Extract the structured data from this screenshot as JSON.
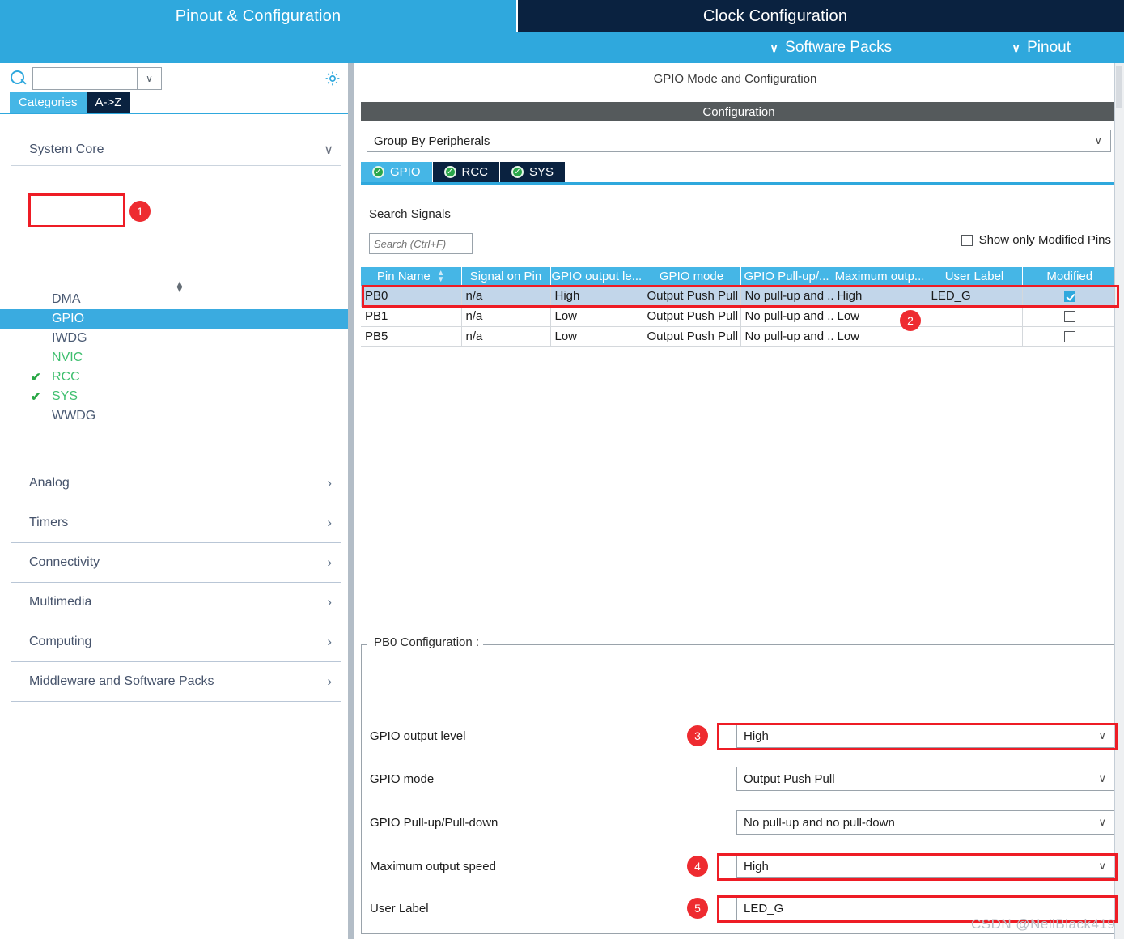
{
  "main_tabs": [
    {
      "label": "Pinout & Configuration",
      "active": true
    },
    {
      "label": "Clock Configuration",
      "active": false
    }
  ],
  "second_bar": {
    "software_packs": "Software Packs",
    "pinout": "Pinout",
    "chevron": "∨"
  },
  "left_panel": {
    "search": {
      "value": "",
      "placeholder": ""
    },
    "gear_icon": "gear-icon",
    "tabs": [
      {
        "label": "Categories",
        "active": true
      },
      {
        "label": "A->Z",
        "active": false
      }
    ],
    "section": {
      "label": "System Core",
      "arrow": "∨"
    },
    "tree_items": [
      {
        "label": "DMA",
        "check": false,
        "green": false,
        "selected": false
      },
      {
        "label": "GPIO",
        "check": false,
        "green": false,
        "selected": true
      },
      {
        "label": "IWDG",
        "check": false,
        "green": false,
        "selected": false
      },
      {
        "label": "NVIC",
        "check": false,
        "green": true,
        "selected": false
      },
      {
        "label": "RCC",
        "check": true,
        "green": true,
        "selected": false
      },
      {
        "label": "SYS",
        "check": true,
        "green": true,
        "selected": false
      },
      {
        "label": "WWDG",
        "check": false,
        "green": false,
        "selected": false
      }
    ],
    "categories": [
      {
        "label": "Analog",
        "arrow": "›"
      },
      {
        "label": "Timers",
        "arrow": "›"
      },
      {
        "label": "Connectivity",
        "arrow": "›"
      },
      {
        "label": "Multimedia",
        "arrow": "›"
      },
      {
        "label": "Computing",
        "arrow": "›"
      },
      {
        "label": "Middleware and Software Packs",
        "arrow": "›"
      }
    ]
  },
  "right_panel": {
    "mode_title": "GPIO Mode and Configuration",
    "configuration_title": "Configuration",
    "group_by": {
      "value": "Group By Peripherals",
      "chevron": "∨"
    },
    "peripheral_tabs": [
      {
        "label": "GPIO",
        "active": true,
        "status": "ok"
      },
      {
        "label": "RCC",
        "active": false,
        "status": "ok"
      },
      {
        "label": "SYS",
        "active": false,
        "status": "ok"
      }
    ],
    "search_signals_label": "Search Signals",
    "search_signals": {
      "value": "",
      "placeholder": "Search (Ctrl+F)"
    },
    "show_only_modified": {
      "label": "Show only Modified Pins",
      "checked": false
    },
    "table": {
      "columns": [
        "Pin Name",
        "Signal on Pin",
        "GPIO output le...",
        "GPIO mode",
        "GPIO Pull-up/...",
        "Maximum outp...",
        "User Label",
        "Modified"
      ],
      "sort_glyph": "⬍",
      "rows": [
        {
          "pin_name": "PB0",
          "signal_on_pin": "n/a",
          "gpio_output_level": "High",
          "gpio_mode": "Output Push Pull",
          "gpio_pull": "No pull-up and ...",
          "maximum_output": "High",
          "user_label": "LED_G",
          "modified": true,
          "selected": true
        },
        {
          "pin_name": "PB1",
          "signal_on_pin": "n/a",
          "gpio_output_level": "Low",
          "gpio_mode": "Output Push Pull",
          "gpio_pull": "No pull-up and ...",
          "maximum_output": "Low",
          "user_label": "",
          "modified": false,
          "selected": false
        },
        {
          "pin_name": "PB5",
          "signal_on_pin": "n/a",
          "gpio_output_level": "Low",
          "gpio_mode": "Output Push Pull",
          "gpio_pull": "No pull-up and ...",
          "maximum_output": "Low",
          "user_label": "",
          "modified": false,
          "selected": false
        }
      ]
    },
    "pin_config": {
      "title": "PB0 Configuration :",
      "fields": [
        {
          "label": "GPIO output level",
          "value": "High",
          "type": "select",
          "chevron": "∨"
        },
        {
          "label": "GPIO mode",
          "value": "Output Push Pull",
          "type": "select",
          "chevron": "∨"
        },
        {
          "label": "GPIO Pull-up/Pull-down",
          "value": "No pull-up and no pull-down",
          "type": "select",
          "chevron": "∨"
        },
        {
          "label": "Maximum output speed",
          "value": "High",
          "type": "select",
          "chevron": "∨"
        },
        {
          "label": "User Label",
          "value": "LED_G",
          "type": "text",
          "chevron": ""
        }
      ]
    }
  },
  "annotations": {
    "badges": [
      "1",
      "2",
      "3",
      "4",
      "5"
    ]
  },
  "watermark": "CSDN @NeilBlack419",
  "colors": {
    "accent_blue": "#2fa8dd",
    "tab_light": "#45b6e6",
    "navy": "#0a2240",
    "annotation_red": "#ee1c25",
    "badge_red": "#ee2b30",
    "green": "#2aa74a",
    "row_selected": "#c2d6ea"
  }
}
